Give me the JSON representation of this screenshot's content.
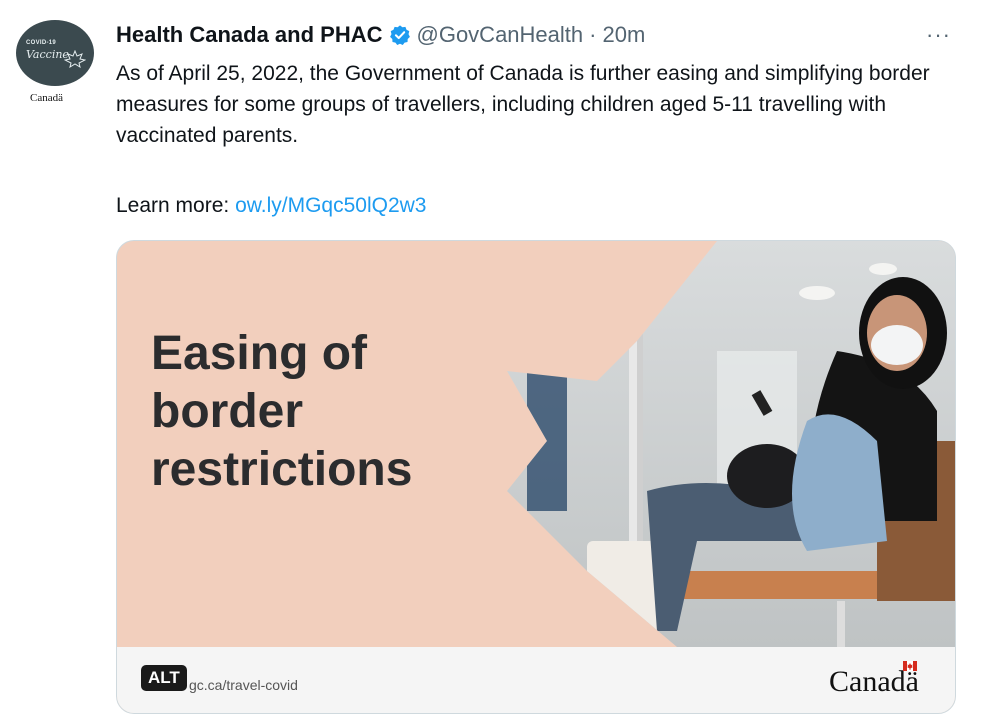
{
  "tweet": {
    "avatar": {
      "label_small": "COVID-19",
      "label_main": "Vaccine",
      "wordmark": "Canadä"
    },
    "display_name": "Health Canada and PHAC",
    "handle": "@GovCanHealth",
    "separator": "·",
    "time": "20m",
    "more": "···",
    "text": "As of April 25, 2022, the Government of Canada is further easing and simplifying border measures for some groups of travellers, including children aged 5-11 travelling with vaccinated parents.",
    "learn_more_prefix": "Learn more: ",
    "link_text": "ow.ly/MGqc50lQ2w3"
  },
  "card": {
    "title_lines": [
      "Easing of",
      "border",
      "restrictions"
    ],
    "alt_label": "ALT",
    "url": "gc.ca/travel-covid",
    "wordmark": "Canadä"
  },
  "colors": {
    "accent": "#1d9bf0",
    "card_bg": "#f2cfbd",
    "title": "#2b2c2e"
  }
}
